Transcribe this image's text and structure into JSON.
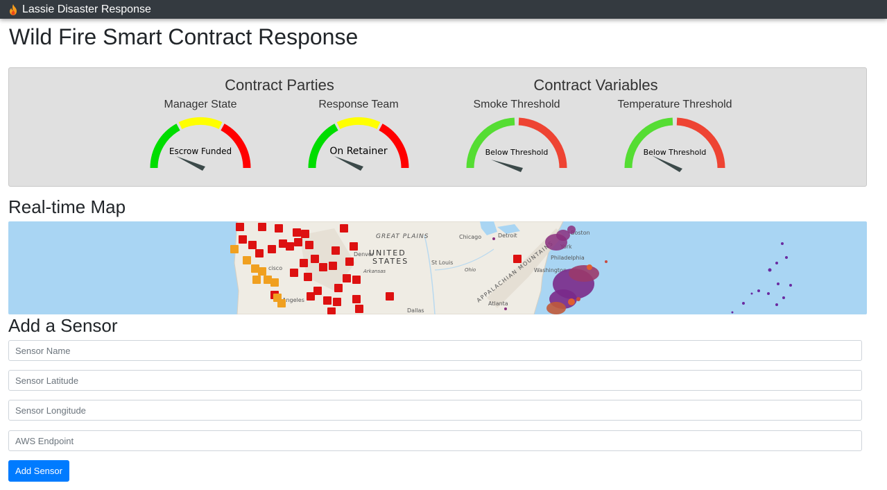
{
  "navbar": {
    "brand": "Lassie Disaster Response",
    "brand_icon": "fire-icon"
  },
  "page": {
    "title": "Wild Fire Smart Contract Response"
  },
  "contract_parties": {
    "title": "Contract Parties",
    "gauges": [
      {
        "label": "Manager State",
        "value_text": "Escrow Funded",
        "segments": [
          "#00dd00",
          "#ffff00",
          "#ff0000"
        ]
      },
      {
        "label": "Response Team",
        "value_text": "On Retainer",
        "segments": [
          "#00dd00",
          "#ffff00",
          "#ff0000"
        ]
      }
    ]
  },
  "contract_variables": {
    "title": "Contract Variables",
    "gauges": [
      {
        "label": "Smoke Threshold",
        "value_text": "Below Threshold",
        "segments": [
          "#55dd33",
          "#ee4433"
        ]
      },
      {
        "label": "Temperature Threshold",
        "value_text": "Below Threshold",
        "segments": [
          "#55dd33",
          "#ee4433"
        ]
      }
    ]
  },
  "map": {
    "title": "Real-time Map",
    "labels": [
      "GREAT PLAINS",
      "UNITED",
      "STATES",
      "Chicago",
      "Detroit",
      "Boston",
      "York",
      "Philadelphia",
      "Washington",
      "St Louis",
      "Ohio",
      "Arkansas",
      "Denver",
      "Dallas",
      "Atlanta",
      "APPALACHIAN MOUNTAINS",
      "cisco",
      "Angeles"
    ]
  },
  "add_sensor": {
    "title": "Add a Sensor",
    "fields": [
      {
        "placeholder": "Sensor Name"
      },
      {
        "placeholder": "Sensor Latitude"
      },
      {
        "placeholder": "Sensor Longitude"
      },
      {
        "placeholder": "AWS Endpoint"
      }
    ],
    "button_label": "Add Sensor"
  },
  "colors": {
    "navbar": "#343a40",
    "primary": "#007bff",
    "fire_marker": "#dd1111",
    "alert_marker": "#f0a020",
    "smoke_dots": "#7a2a8a"
  }
}
